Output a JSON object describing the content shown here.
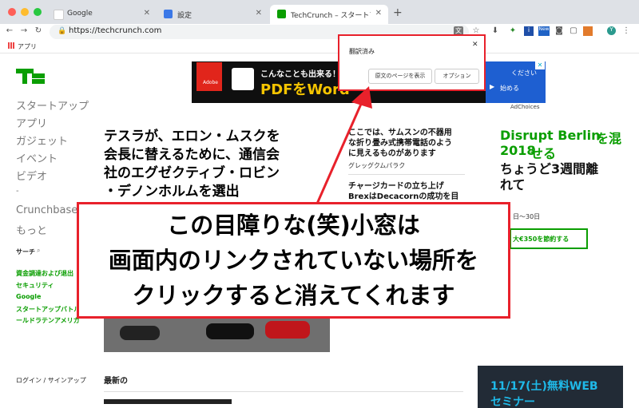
{
  "browser": {
    "tabs": [
      {
        "title": "Google",
        "active": false
      },
      {
        "title": "設定",
        "active": false
      },
      {
        "title": "TechCrunch – スタートアップと",
        "active": true
      }
    ],
    "url": "https://techcrunch.com",
    "bookmarks": {
      "apps_label": "アプリ"
    },
    "toolbar_icons": [
      "translate-icon",
      "star-icon",
      "extension-icon",
      "avatar-icon"
    ],
    "new_badge": "New"
  },
  "site": {
    "logo": "TC",
    "nav": [
      "スタートアップ",
      "アプリ",
      "ガジェット",
      "イベント",
      "ビデオ",
      "-",
      "Crunchbase",
      "もっと"
    ],
    "search_label": "サーチ",
    "side_links": [
      "資金調達および退出",
      "セキュリティ",
      "Google",
      "スタートアップバトル",
      "ールドラテンアメリカ"
    ],
    "login": "ログイン / サインアップ",
    "latest": "最新の"
  },
  "ad": {
    "text1": "こんなことも出来る！ A",
    "text2": "PDFをWord",
    "right1": "ください",
    "right2": "始める",
    "brand": "Adobe",
    "adchoices": "AdChoices"
  },
  "main": {
    "headline": [
      "テスラが、エロン・ムスクを",
      "会長に替えるために、通信会",
      "社のエグゼクティブ・ロビン",
      "・デノンホルムを選出"
    ],
    "article2": [
      "ここでは、サムスンの不器用",
      "な折り畳み式携帯電話のよう",
      "に見えるものがあります"
    ],
    "article2_author": "グレッグクムパラク",
    "article3": [
      "チャージカードの立ち上げ",
      "BrexはDecacornの成功を目"
    ],
    "right_green": [
      "Disrupt Berlin",
      "2018"
    ],
    "right_green_tail": "を混",
    "right_green_tail2": "せる",
    "right_black": [
      "ちょうど3週間離",
      "れて"
    ],
    "date_range": "日〜30日",
    "cta": "大€350を節約する",
    "card_text": [
      "11/17(土)無料WEB",
      "セミナー"
    ]
  },
  "popup": {
    "title": "翻訳済み",
    "btn_original": "原文のページを表示",
    "btn_options": "オプション"
  },
  "overlay": {
    "lines": [
      "この目障りな(笑)小窓は",
      "画面内のリンクされていない場所を",
      "クリックすると消えてくれます"
    ]
  },
  "colors": {
    "accent_green": "#0a9e01",
    "annotation_red": "#e8212b"
  }
}
